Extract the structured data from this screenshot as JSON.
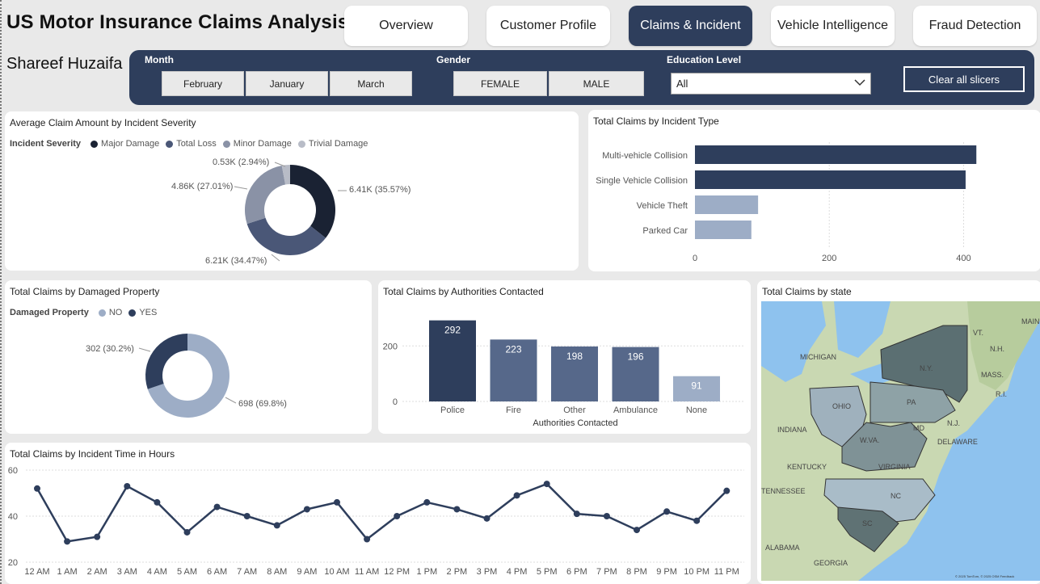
{
  "header": {
    "title": "US Motor Insurance Claims Analysis",
    "author": "Shareef Huzaifa"
  },
  "nav": {
    "tabs": [
      {
        "label": "Overview",
        "active": false
      },
      {
        "label": "Customer Profile",
        "active": false
      },
      {
        "label": "Claims & Incident",
        "active": true
      },
      {
        "label": "Vehicle Intelligence",
        "active": false
      },
      {
        "label": "Fraud Detection",
        "active": false
      }
    ]
  },
  "slicers": {
    "month": {
      "label": "Month",
      "options": [
        "February",
        "January",
        "March"
      ]
    },
    "gender": {
      "label": "Gender",
      "options": [
        "FEMALE",
        "MALE"
      ]
    },
    "education": {
      "label": "Education Level",
      "value": "All"
    },
    "clear_label": "Clear all slicers"
  },
  "colors": {
    "accent": "#2e3e5c",
    "major": "#1a2233",
    "total_loss": "#4a5777",
    "minor": "#8a92a6",
    "trivial": "#b8bcc7",
    "light_blue": "#9dadc6",
    "mid_blue": "#56688a"
  },
  "severity_panel": {
    "title": "Average Claim Amount by Incident Severity",
    "legend_title": "Incident Severity",
    "legend": [
      "Major Damage",
      "Total Loss",
      "Minor Damage",
      "Trivial Damage"
    ]
  },
  "incident_type_panel": {
    "title": "Total Claims by Incident Type"
  },
  "damaged_property_panel": {
    "title": "Total Claims by Damaged Property",
    "legend_title": "Damaged Property",
    "legend": [
      "NO",
      "YES"
    ]
  },
  "authorities_panel": {
    "title": "Total Claims by Authorities Contacted"
  },
  "time_panel": {
    "title": "Total Claims by Incident Time in Hours"
  },
  "map_panel": {
    "title": "Total Claims by state",
    "labels": [
      "MICHIGAN",
      "OHIO",
      "INDIANA",
      "KENTUCKY",
      "TENNESSEE",
      "ALABAMA",
      "GEORGIA",
      "N.Y.",
      "PA",
      "MD",
      "W.VA.",
      "VIRGINIA",
      "NC",
      "SC",
      "N.J.",
      "DELAWARE",
      "MASS.",
      "VT.",
      "N.H.",
      "R.I.",
      "MAINE"
    ],
    "attribution": "© 2025 TomTom, © 2025 OSM Feedback"
  },
  "chart_data": [
    {
      "type": "pie",
      "title": "Average Claim Amount by Incident Severity",
      "donut": true,
      "categories": [
        "Major Damage",
        "Total Loss",
        "Minor Damage",
        "Trivial Damage"
      ],
      "values": [
        6410,
        6210,
        4860,
        530
      ],
      "labels": [
        "6.41K (35.57%)",
        "6.21K (34.47%)",
        "4.86K (27.01%)",
        "0.53K (2.94%)"
      ],
      "percents": [
        35.57,
        34.47,
        27.01,
        2.94
      ]
    },
    {
      "type": "bar",
      "orientation": "horizontal",
      "title": "Total Claims by Incident Type",
      "categories": [
        "Multi-vehicle Collision",
        "Single Vehicle Collision",
        "Vehicle Theft",
        "Parked Car"
      ],
      "values": [
        419,
        403,
        94,
        84
      ],
      "xlim": [
        0,
        450
      ],
      "ticks": [
        0,
        200,
        400
      ]
    },
    {
      "type": "pie",
      "title": "Total Claims by Damaged Property",
      "donut": true,
      "categories": [
        "NO",
        "YES"
      ],
      "values": [
        698,
        302
      ],
      "labels": [
        "698 (69.8%)",
        "302 (30.2%)"
      ]
    },
    {
      "type": "bar",
      "title": "Total Claims by Authorities Contacted",
      "xlabel": "Authorities Contacted",
      "categories": [
        "Police",
        "Fire",
        "Other",
        "Ambulance",
        "None"
      ],
      "values": [
        292,
        223,
        198,
        196,
        91
      ],
      "ylim": [
        0,
        320
      ],
      "ticks": [
        0,
        200
      ]
    },
    {
      "type": "line",
      "title": "Total Claims by Incident Time in Hours",
      "x": [
        "12 AM",
        "1 AM",
        "2 AM",
        "3 AM",
        "4 AM",
        "5 AM",
        "6 AM",
        "7 AM",
        "8 AM",
        "9 AM",
        "10 AM",
        "11 AM",
        "12 PM",
        "1 PM",
        "2 PM",
        "3 PM",
        "4 PM",
        "5 PM",
        "6 PM",
        "7 PM",
        "8 PM",
        "9 PM",
        "10 PM",
        "11 PM"
      ],
      "values": [
        52,
        29,
        31,
        53,
        46,
        33,
        44,
        40,
        36,
        43,
        46,
        30,
        40,
        46,
        43,
        39,
        49,
        54,
        41,
        40,
        34,
        42,
        38,
        51
      ],
      "ylim": [
        20,
        60
      ],
      "ticks": [
        20,
        40,
        60
      ]
    }
  ]
}
